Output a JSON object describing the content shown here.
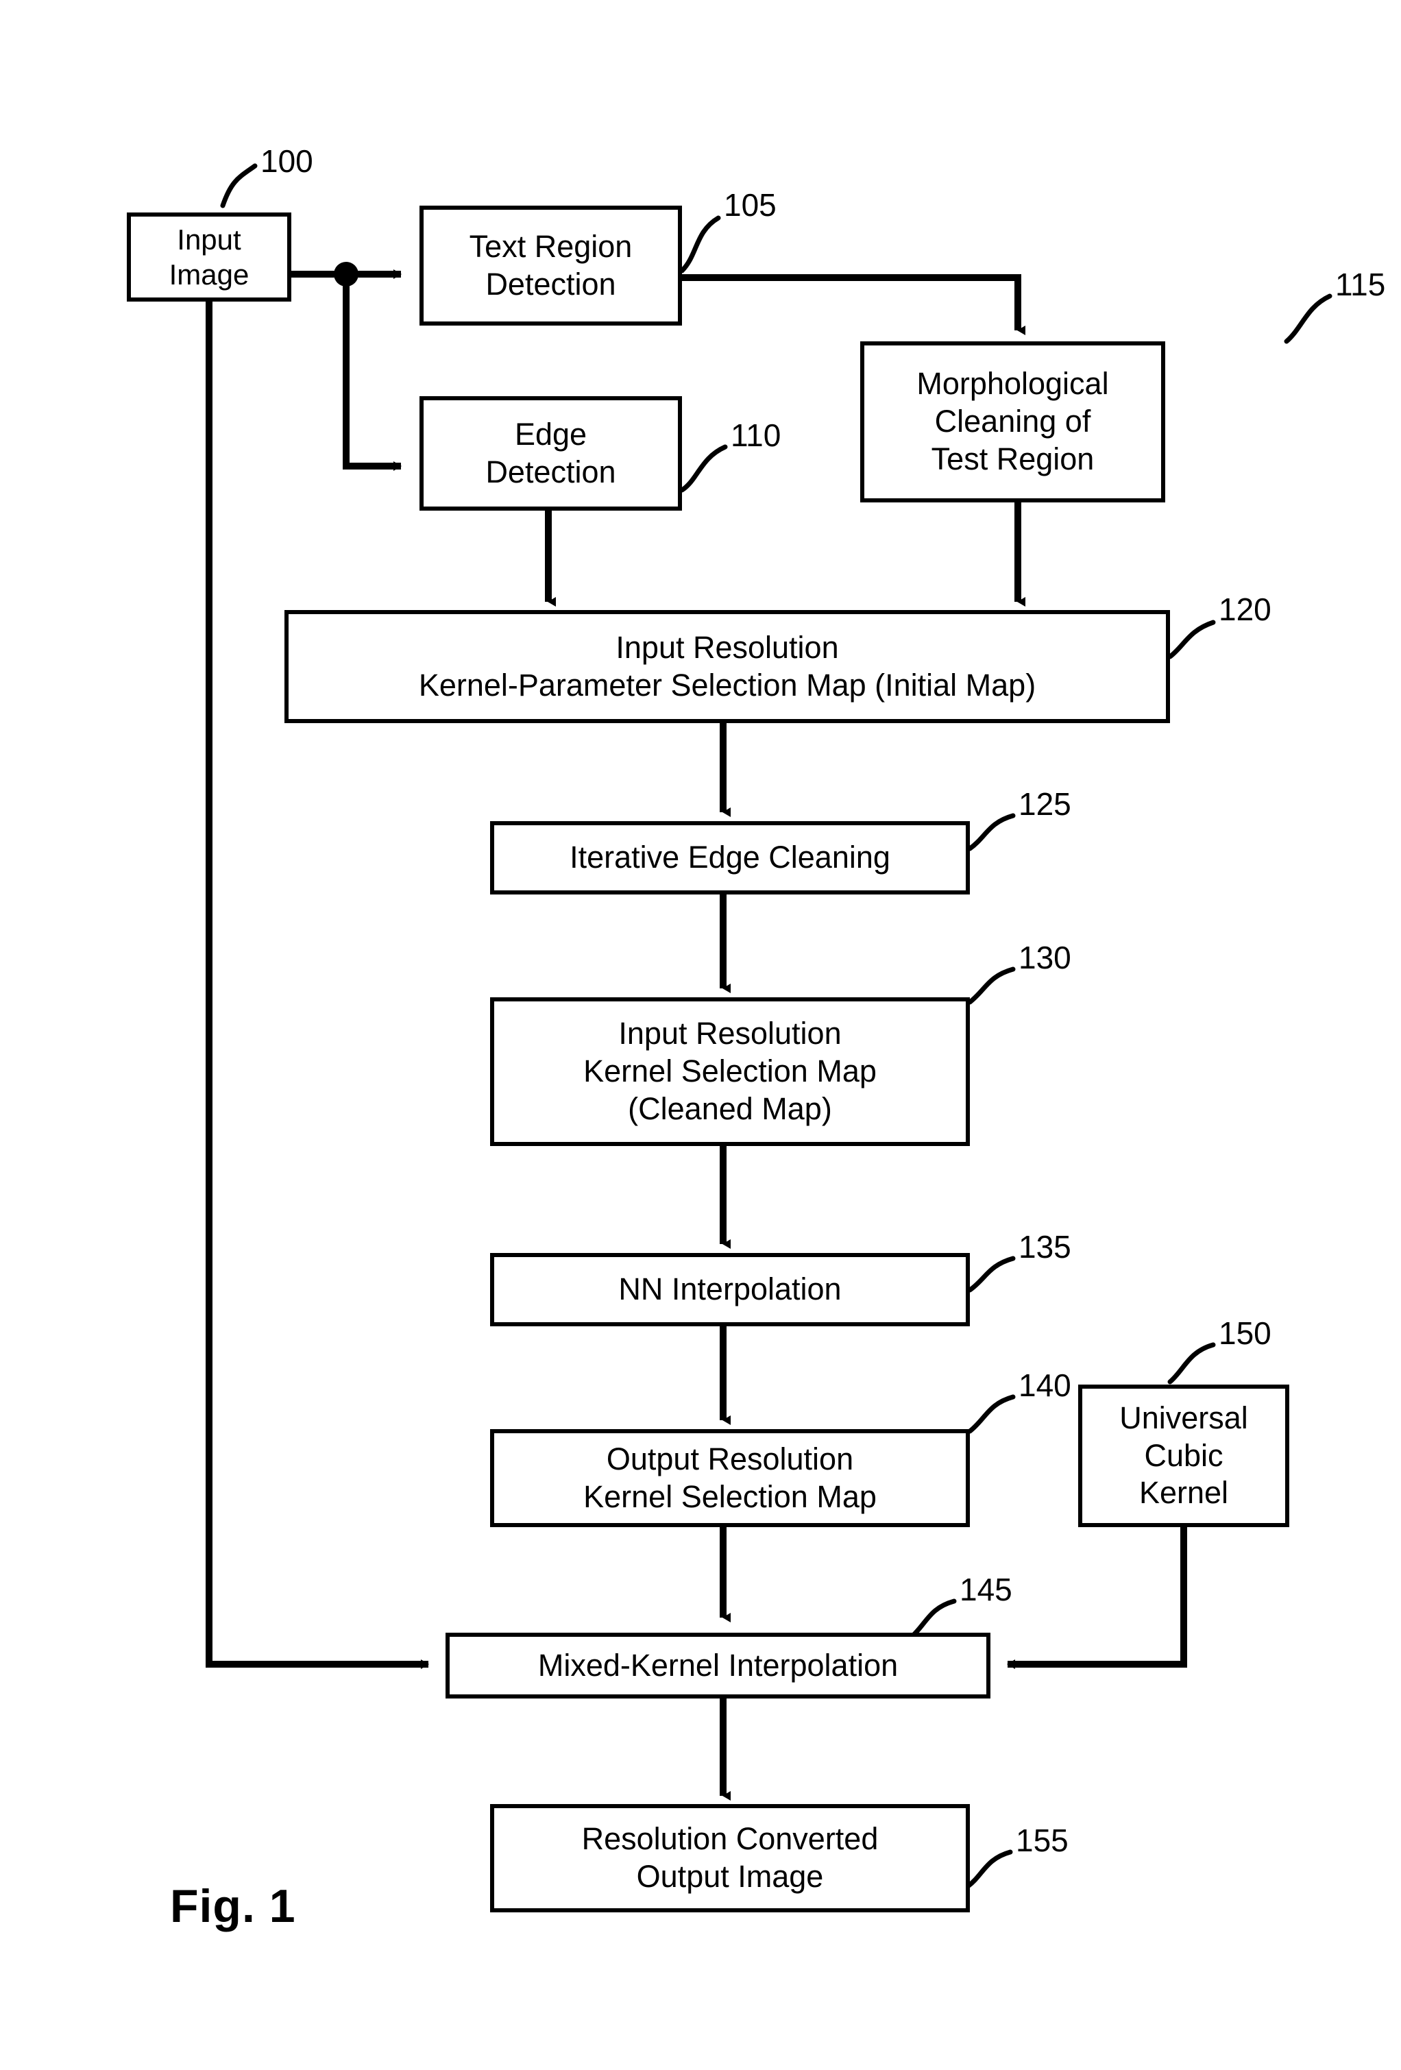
{
  "figure": {
    "label": "Fig. 1",
    "title": "Resolution conversion process block diagram"
  },
  "nodes": [
    {
      "id": "input_image",
      "ref": "100",
      "lines": [
        "Input",
        "Image"
      ]
    },
    {
      "id": "text_region_detection",
      "ref": "105",
      "lines": [
        "Text Region",
        "Detection"
      ]
    },
    {
      "id": "edge_detection",
      "ref": "110",
      "lines": [
        "Edge",
        "Detection"
      ]
    },
    {
      "id": "morphological_cleaning",
      "ref": "115",
      "lines": [
        "Morphological",
        "Cleaning of",
        "Test Region"
      ]
    },
    {
      "id": "initial_map",
      "ref": "120",
      "lines": [
        "Input Resolution",
        "Kernel-Parameter Selection Map (Initial Map)"
      ]
    },
    {
      "id": "iterative_edge_cleaning",
      "ref": "125",
      "lines": [
        "Iterative Edge Cleaning"
      ]
    },
    {
      "id": "cleaned_map",
      "ref": "130",
      "lines": [
        "Input Resolution",
        "Kernel Selection Map",
        "(Cleaned Map)"
      ]
    },
    {
      "id": "nn_interpolation",
      "ref": "135",
      "lines": [
        "NN Interpolation"
      ]
    },
    {
      "id": "output_map",
      "ref": "140",
      "lines": [
        "Output Resolution",
        "Kernel Selection Map"
      ]
    },
    {
      "id": "mixed_kernel_interpolation",
      "ref": "145",
      "lines": [
        "Mixed-Kernel Interpolation"
      ]
    },
    {
      "id": "universal_cubic_kernel",
      "ref": "150",
      "lines": [
        "Universal",
        "Cubic",
        "Kernel"
      ]
    },
    {
      "id": "output_image",
      "ref": "155",
      "lines": [
        "Resolution Converted",
        "Output Image"
      ]
    }
  ],
  "edges": [
    {
      "from": "input_image",
      "to": "text_region_detection"
    },
    {
      "from": "input_image",
      "to": "edge_detection"
    },
    {
      "from": "input_image",
      "to": "mixed_kernel_interpolation"
    },
    {
      "from": "text_region_detection",
      "to": "morphological_cleaning"
    },
    {
      "from": "edge_detection",
      "to": "initial_map"
    },
    {
      "from": "morphological_cleaning",
      "to": "initial_map"
    },
    {
      "from": "initial_map",
      "to": "iterative_edge_cleaning"
    },
    {
      "from": "iterative_edge_cleaning",
      "to": "cleaned_map"
    },
    {
      "from": "cleaned_map",
      "to": "nn_interpolation"
    },
    {
      "from": "nn_interpolation",
      "to": "output_map"
    },
    {
      "from": "output_map",
      "to": "mixed_kernel_interpolation"
    },
    {
      "from": "universal_cubic_kernel",
      "to": "mixed_kernel_interpolation"
    },
    {
      "from": "mixed_kernel_interpolation",
      "to": "output_image"
    }
  ],
  "colors": {
    "stroke": "#000000",
    "background": "#ffffff"
  }
}
